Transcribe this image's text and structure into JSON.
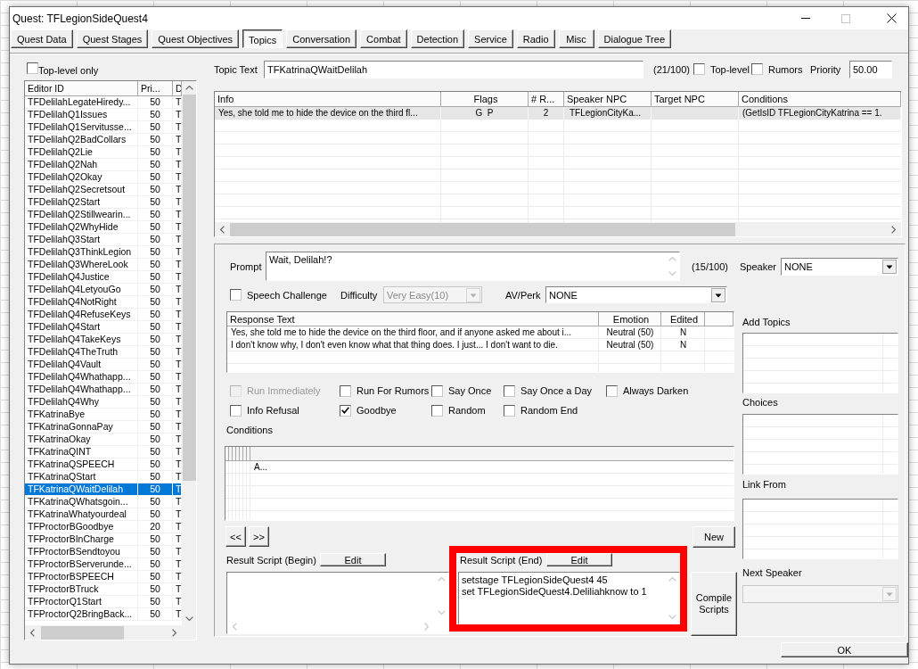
{
  "window": {
    "title": "Quest: TFLegionSideQuest4"
  },
  "tabs": [
    {
      "label": "Quest Data",
      "selected": false
    },
    {
      "label": "Quest Stages",
      "selected": false
    },
    {
      "label": "Quest Objectives",
      "selected": false
    },
    {
      "label": "Topics",
      "selected": true
    },
    {
      "label": "Conversation",
      "selected": false
    },
    {
      "label": "Combat",
      "selected": false
    },
    {
      "label": "Detection",
      "selected": false
    },
    {
      "label": "Service",
      "selected": false
    },
    {
      "label": "Radio",
      "selected": false
    },
    {
      "label": "Misc",
      "selected": false
    },
    {
      "label": "Dialogue Tree",
      "selected": false
    }
  ],
  "topic_list": {
    "top_level_only": {
      "label": "Top-level only",
      "checked": false
    },
    "columns": [
      "Editor ID",
      "Pri...",
      "D"
    ],
    "rows": [
      {
        "editor_id": "TFDelilahLegateHiredy...",
        "priority": "50",
        "column_3": "T",
        "selected": false
      },
      {
        "editor_id": "TFDelilahQ1Issues",
        "priority": "50",
        "column_3": "T",
        "selected": false
      },
      {
        "editor_id": "TFDelilahQ1Servitusse...",
        "priority": "50",
        "column_3": "T",
        "selected": false
      },
      {
        "editor_id": "TFDelilahQ2BadCollars",
        "priority": "50",
        "column_3": "T",
        "selected": false
      },
      {
        "editor_id": "TFDelilahQ2Lie",
        "priority": "50",
        "column_3": "T",
        "selected": false
      },
      {
        "editor_id": "TFDelilahQ2Nah",
        "priority": "50",
        "column_3": "T",
        "selected": false
      },
      {
        "editor_id": "TFDelilahQ2Okay",
        "priority": "50",
        "column_3": "T",
        "selected": false
      },
      {
        "editor_id": "TFDelilahQ2Secretsout",
        "priority": "50",
        "column_3": "T",
        "selected": false
      },
      {
        "editor_id": "TFDelilahQ2Start",
        "priority": "50",
        "column_3": "T",
        "selected": false
      },
      {
        "editor_id": "TFDelilahQ2Stillwearin...",
        "priority": "50",
        "column_3": "T",
        "selected": false
      },
      {
        "editor_id": "TFDelilahQ2WhyHide",
        "priority": "50",
        "column_3": "T",
        "selected": false
      },
      {
        "editor_id": "TFDelilahQ3Start",
        "priority": "50",
        "column_3": "T",
        "selected": false
      },
      {
        "editor_id": "TFDelilahQ3ThinkLegion",
        "priority": "50",
        "column_3": "T",
        "selected": false
      },
      {
        "editor_id": "TFDelilahQ3WhereLook",
        "priority": "50",
        "column_3": "T",
        "selected": false
      },
      {
        "editor_id": "TFDelilahQ4Justice",
        "priority": "50",
        "column_3": "T",
        "selected": false
      },
      {
        "editor_id": "TFDelilahQ4LetyouGo",
        "priority": "50",
        "column_3": "T",
        "selected": false
      },
      {
        "editor_id": "TFDelilahQ4NotRight",
        "priority": "50",
        "column_3": "T",
        "selected": false
      },
      {
        "editor_id": "TFDelilahQ4RefuseKeys",
        "priority": "50",
        "column_3": "T",
        "selected": false
      },
      {
        "editor_id": "TFDelilahQ4Start",
        "priority": "50",
        "column_3": "T",
        "selected": false
      },
      {
        "editor_id": "TFDelilahQ4TakeKeys",
        "priority": "50",
        "column_3": "T",
        "selected": false
      },
      {
        "editor_id": "TFDelilahQ4TheTruth",
        "priority": "50",
        "column_3": "T",
        "selected": false
      },
      {
        "editor_id": "TFDelilahQ4Vault",
        "priority": "50",
        "column_3": "T",
        "selected": false
      },
      {
        "editor_id": "TFDelilahQ4Whathapp...",
        "priority": "50",
        "column_3": "T",
        "selected": false
      },
      {
        "editor_id": "TFDelilahQ4Whathapp...",
        "priority": "50",
        "column_3": "T",
        "selected": false
      },
      {
        "editor_id": "TFDelilahQ4Why",
        "priority": "50",
        "column_3": "T",
        "selected": false
      },
      {
        "editor_id": "TFKatrinaBye",
        "priority": "50",
        "column_3": "T",
        "selected": false
      },
      {
        "editor_id": "TFKatrinaGonnaPay",
        "priority": "50",
        "column_3": "T",
        "selected": false
      },
      {
        "editor_id": "TFKatrinaOkay",
        "priority": "50",
        "column_3": "T",
        "selected": false
      },
      {
        "editor_id": "TFKatrinaQINT",
        "priority": "50",
        "column_3": "T",
        "selected": false
      },
      {
        "editor_id": "TFKatrinaQSPEECH",
        "priority": "50",
        "column_3": "T",
        "selected": false
      },
      {
        "editor_id": "TFKatrinaQStart",
        "priority": "50",
        "column_3": "T",
        "selected": false
      },
      {
        "editor_id": "TFKatrinaQWaitDelilah",
        "priority": "50",
        "column_3": "T",
        "selected": true
      },
      {
        "editor_id": "TFKatrinaQWhatsgoin...",
        "priority": "50",
        "column_3": "T",
        "selected": false
      },
      {
        "editor_id": "TFKatrinaWhatyourdeal",
        "priority": "50",
        "column_3": "T",
        "selected": false
      },
      {
        "editor_id": "TFProctorBGoodbye",
        "priority": "20",
        "column_3": "T",
        "selected": false
      },
      {
        "editor_id": "TFProctorBInCharge",
        "priority": "50",
        "column_3": "T",
        "selected": false
      },
      {
        "editor_id": "TFProctorBSendtoyou",
        "priority": "50",
        "column_3": "T",
        "selected": false
      },
      {
        "editor_id": "TFProctorBServerunde...",
        "priority": "50",
        "column_3": "T",
        "selected": false
      },
      {
        "editor_id": "TFProctorBSPEECH",
        "priority": "50",
        "column_3": "T",
        "selected": false
      },
      {
        "editor_id": "TFProctorBTruck",
        "priority": "50",
        "column_3": "T",
        "selected": false
      },
      {
        "editor_id": "TFProctorQ1Start",
        "priority": "50",
        "column_3": "T",
        "selected": false
      },
      {
        "editor_id": "TFProctorQ2BringBack...",
        "priority": "50",
        "column_3": "T",
        "selected": false
      }
    ]
  },
  "topic_text": {
    "label": "Topic Text",
    "value": "TFKatrinaQWaitDelilah",
    "count": "(21/100)"
  },
  "topic_options": [
    {
      "label": "Top-level",
      "checked": false
    },
    {
      "label": "Rumors",
      "checked": false
    }
  ],
  "priority": {
    "label": "Priority",
    "value": "50.00"
  },
  "info_table": {
    "columns": [
      "Info",
      "Flags",
      "# R...",
      "Speaker NPC",
      "Target NPC",
      "Conditions"
    ],
    "rows": [
      {
        "info": "Yes, she told me to hide the device on the third fl...",
        "flags": "G  P",
        "responses": "2",
        "speaker_npc": "TFLegionCityKa...",
        "conditions": "(GetIsID TFLegionCityKatrina == 1.",
        "selected": true
      }
    ]
  },
  "prompt": {
    "label": "Prompt",
    "value": "Wait, Delilah!?",
    "count": "(15/100)"
  },
  "speaker": {
    "label": "Speaker",
    "value": "NONE"
  },
  "speech_challenge": {
    "label": "Speech Challenge",
    "checked": false
  },
  "difficulty": {
    "label": "Difficulty",
    "value": "Very Easy(10)",
    "disabled": true
  },
  "av_perk": {
    "label": "AV/Perk",
    "value": "NONE"
  },
  "responses": {
    "columns": [
      "Response Text",
      "Emotion",
      "Edited"
    ],
    "rows": [
      {
        "text": "Yes, she told me to hide the device on the third floor, and if anyone asked me about i...",
        "emotion": "Neutral (50)",
        "edited": "N"
      },
      {
        "text": "I don't know why, I don't even know what that thing does. I just... I don't want to die.",
        "emotion": "Neutral (50)",
        "edited": "N"
      }
    ]
  },
  "response_flags": [
    {
      "label": "Run Immediately",
      "checked": false,
      "disabled": true
    },
    {
      "label": "Run For Rumors",
      "checked": false,
      "disabled": false
    },
    {
      "label": "Say Once",
      "checked": false,
      "disabled": false
    },
    {
      "label": "Say Once a Day",
      "checked": false,
      "disabled": false
    },
    {
      "label": "Always Darken",
      "checked": false,
      "disabled": false
    },
    {
      "label": "Info Refusal",
      "checked": false,
      "disabled": false
    },
    {
      "label": "Goodbye",
      "checked": true,
      "disabled": false
    },
    {
      "label": "Random",
      "checked": false,
      "disabled": false
    },
    {
      "label": "Random End",
      "checked": false,
      "disabled": false
    }
  ],
  "conditions": {
    "label": "Conditions",
    "rows": [
      "A..."
    ]
  },
  "navigation": [
    "<<",
    ">>"
  ],
  "new_button": "New",
  "result_script_begin": {
    "label": "Result Script (Begin)",
    "button": "Edit"
  },
  "result_script_end": {
    "label": "Result Script (End)",
    "button": "Edit",
    "lines": [
      "setstage TFLegionSideQuest4 45",
      "set TFLegionSideQuest4.Deliliahknow to 1"
    ]
  },
  "compile_button": "Compile Scripts",
  "link_lists": [
    {
      "label": "Add Topics"
    },
    {
      "label": "Choices"
    },
    {
      "label": "Link From"
    }
  ],
  "next_speaker": {
    "label": "Next Speaker",
    "disabled": true
  },
  "ok_button": "OK"
}
